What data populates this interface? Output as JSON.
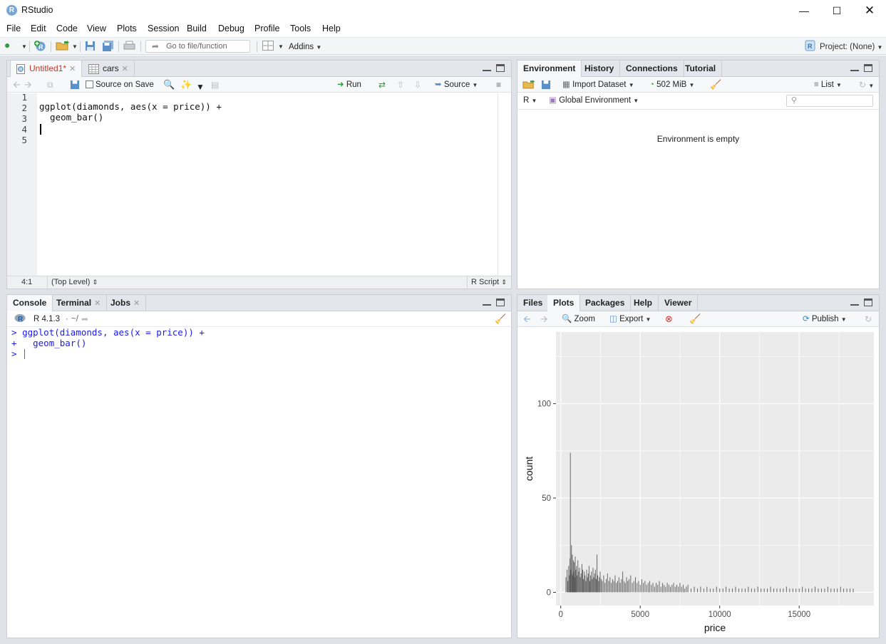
{
  "window": {
    "title": "RStudio",
    "app_icon": "R",
    "controls": [
      "minimize",
      "maximize",
      "close"
    ]
  },
  "menu": [
    "File",
    "Edit",
    "Code",
    "View",
    "Plots",
    "Session",
    "Build",
    "Debug",
    "Profile",
    "Tools",
    "Help"
  ],
  "toolbar": {
    "goto_placeholder": "Go to file/function",
    "addins_label": "Addins",
    "project_label": "Project: (None)"
  },
  "editor": {
    "tabs": [
      {
        "label": "Untitled1*",
        "active": true,
        "color": "#c0392b"
      },
      {
        "label": "cars",
        "active": false
      }
    ],
    "source_on_save_label": "Source on Save",
    "run_label": "Run",
    "source_label": "Source",
    "line_numbers": [
      "1",
      "2",
      "3",
      "4",
      "5"
    ],
    "lines": [
      "",
      "ggplot(diamonds, aes(x = price)) +",
      "  geom_bar()",
      "",
      ""
    ],
    "status": {
      "position": "4:1",
      "scope": "(Top Level)",
      "file_type": "R Script"
    }
  },
  "environment_pane": {
    "tabs": [
      "Environment",
      "History",
      "Connections",
      "Tutorial"
    ],
    "import_dataset_label": "Import Dataset",
    "memory_label": "502 MiB",
    "list_label": "List",
    "language_label": "R",
    "scope_label": "Global Environment",
    "search_placeholder": "",
    "empty_message": "Environment is empty"
  },
  "console_pane": {
    "tabs": [
      "Console",
      "Terminal",
      "Jobs"
    ],
    "r_version": "R 4.1.3",
    "working_dir": "~/",
    "lines": [
      {
        "prompt": ">",
        "text": "ggplot(diamonds, aes(x = price)) +"
      },
      {
        "prompt": "+",
        "text": "  geom_bar()"
      },
      {
        "prompt": ">",
        "text": ""
      }
    ],
    "prompt_color": "#1a1af0"
  },
  "plots_pane": {
    "tabs": [
      "Files",
      "Plots",
      "Packages",
      "Help",
      "Viewer"
    ],
    "zoom_label": "Zoom",
    "export_label": "Export",
    "publish_label": "Publish"
  },
  "chart_data": {
    "type": "bar",
    "xlabel": "price",
    "ylabel": "count",
    "xlim": [
      -300,
      19700
    ],
    "ylim": [
      -7,
      138
    ],
    "x_ticks": [
      0,
      5000,
      10000,
      15000
    ],
    "x_tick_labels": [
      "0",
      "5000",
      "10000",
      "15000"
    ],
    "y_ticks": [
      0,
      50,
      100
    ],
    "y_tick_labels": [
      "0",
      "50",
      "100"
    ],
    "grid": true,
    "panel_background": "#ebebeb",
    "bar_color": "#595959",
    "note": "",
    "x": [
      326,
      400,
      450,
      500,
      550,
      580,
      605,
      630,
      675,
      700,
      730,
      760,
      790,
      820,
      850,
      880,
      910,
      950,
      990,
      1030,
      1080,
      1130,
      1180,
      1230,
      1280,
      1330,
      1380,
      1430,
      1480,
      1530,
      1580,
      1630,
      1680,
      1730,
      1780,
      1830,
      1880,
      1930,
      1980,
      2030,
      2080,
      2130,
      2180,
      2230,
      2280,
      2330,
      2380,
      2430,
      2480,
      2550,
      2620,
      2700,
      2780,
      2860,
      2940,
      3020,
      3100,
      3180,
      3260,
      3340,
      3420,
      3500,
      3580,
      3660,
      3740,
      3820,
      3900,
      3980,
      4060,
      4140,
      4220,
      4300,
      4400,
      4500,
      4600,
      4700,
      4800,
      4900,
      5000,
      5100,
      5200,
      5300,
      5400,
      5500,
      5600,
      5700,
      5800,
      5900,
      6000,
      6100,
      6200,
      6300,
      6400,
      6500,
      6600,
      6700,
      6800,
      6900,
      7000,
      7100,
      7200,
      7300,
      7400,
      7500,
      7600,
      7700,
      7800,
      7900,
      8000,
      8200,
      8400,
      8600,
      8800,
      9000,
      9200,
      9400,
      9600,
      9800,
      10000,
      10200,
      10400,
      10600,
      10800,
      11000,
      11200,
      11400,
      11600,
      11800,
      12000,
      12200,
      12400,
      12600,
      12800,
      13000,
      13200,
      13400,
      13600,
      13800,
      14000,
      14200,
      14400,
      14600,
      14800,
      15000,
      15200,
      15400,
      15600,
      15800,
      16000,
      16200,
      16400,
      16600,
      16800,
      17000,
      17200,
      17400,
      17600,
      17800,
      18000,
      18200,
      18400,
      18600,
      18800
    ],
    "values": [
      8,
      12,
      6,
      14,
      9,
      18,
      74,
      12,
      25,
      10,
      20,
      9,
      17,
      11,
      16,
      8,
      19,
      12,
      14,
      9,
      17,
      11,
      13,
      8,
      10,
      15,
      12,
      7,
      11,
      9,
      6,
      12,
      8,
      10,
      14,
      6,
      9,
      11,
      7,
      13,
      8,
      10,
      12,
      7,
      20,
      9,
      6,
      8,
      11,
      7,
      6,
      9,
      5,
      7,
      10,
      6,
      8,
      5,
      7,
      6,
      9,
      5,
      6,
      8,
      5,
      7,
      11,
      6,
      5,
      8,
      6,
      7,
      9,
      5,
      6,
      8,
      5,
      6,
      4,
      7,
      5,
      6,
      4,
      5,
      6,
      4,
      5,
      3,
      5,
      4,
      6,
      3,
      5,
      4,
      3,
      5,
      4,
      3,
      4,
      5,
      3,
      4,
      3,
      5,
      3,
      4,
      2,
      3,
      4,
      2,
      3,
      2,
      3,
      2,
      3,
      2,
      2,
      3,
      2,
      2,
      3,
      2,
      2,
      3,
      2,
      2,
      2,
      3,
      2,
      2,
      3,
      2,
      2,
      2,
      3,
      2,
      2,
      2,
      2,
      3,
      2,
      2,
      2,
      2,
      3,
      2,
      2,
      2,
      3,
      2,
      2,
      2,
      3,
      2,
      2,
      2,
      3,
      2,
      2,
      2,
      2
    ]
  }
}
